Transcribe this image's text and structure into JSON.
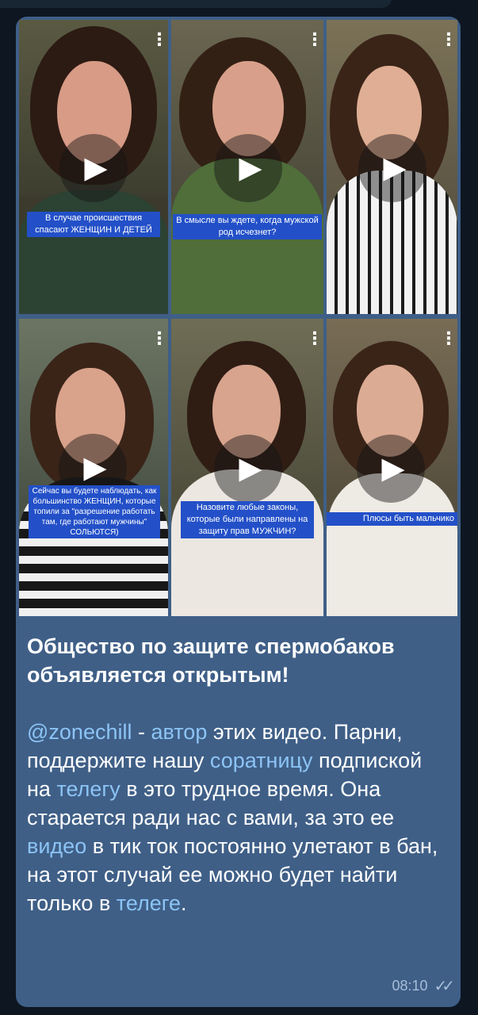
{
  "message": {
    "videos": [
      {
        "caption": "В случае происшествия спасают ЖЕНЩИН И ДЕТЕЙ"
      },
      {
        "caption": "В смысле вы ждете, когда мужской род исчезнет?"
      },
      {
        "caption": ""
      },
      {
        "caption": "Сейчас вы будете наблюдать, как большинство ЖЕНЩИН, которые топили за \"разрешение работать там, где работают мужчины\" СОЛЬЮТСЯ)"
      },
      {
        "caption": "Назовите любые законы, которые были направлены на защиту прав МУЖЧИН?"
      },
      {
        "caption": "Плюсы быть мальчико"
      }
    ],
    "title": "Общество по защите спермобаков объявляется открытым!",
    "body": {
      "mention": "@zonechill",
      "dash": " - ",
      "link_author": "автор",
      "t1": " этих видео. Парни, поддержите нашу ",
      "link_comrade": "соратницу",
      "t2": " подпиской на ",
      "link_telegram": "телегу",
      "t3": " в это трудное время. Она старается ради нас с вами, за это ее ",
      "link_video": "видео",
      "t4": " в тик ток постоянно улетают в бан, на этот случай ее можно будет найти только в ",
      "link_telegram2": "телеге",
      "t5": "."
    },
    "time": "08:10",
    "status_icon": "double-check-icon"
  },
  "icons": {
    "play": "▶",
    "more": "⋮",
    "read": "✓✓"
  },
  "colors": {
    "bubble": "#3f5f87",
    "background": "#0e1621",
    "link": "#8cc4f5",
    "caption_bg": "#2350c8"
  }
}
